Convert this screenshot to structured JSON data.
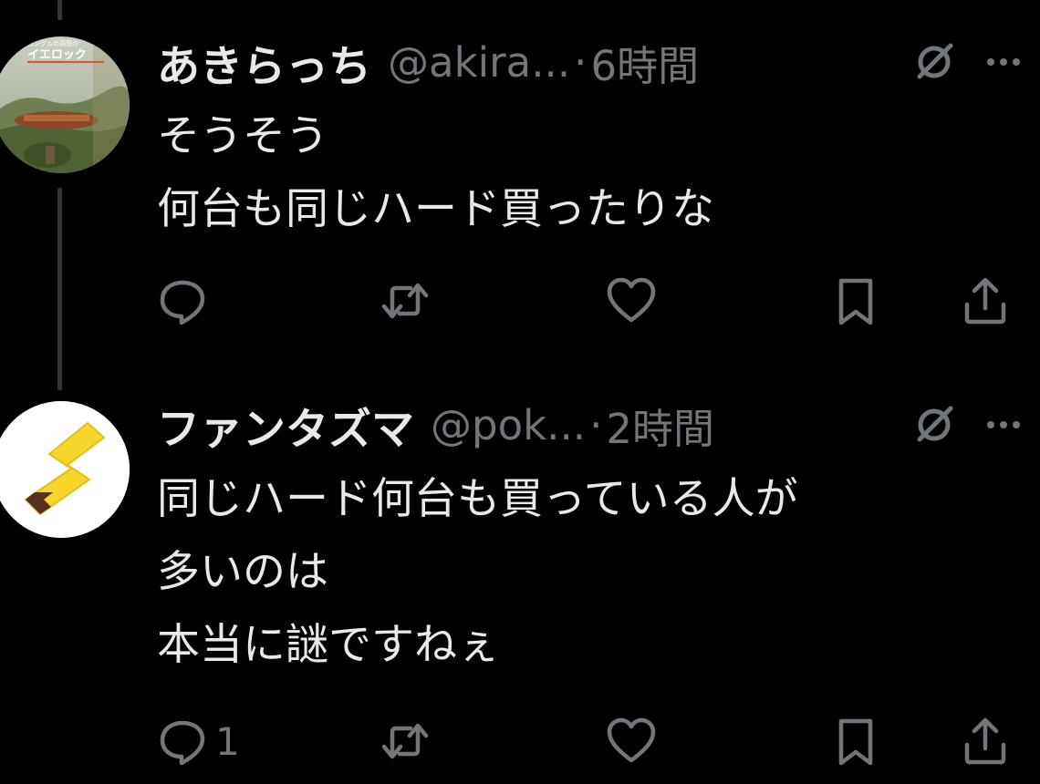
{
  "posts": [
    {
      "display_name": "あきらっち",
      "handle": "@akira...",
      "separator": "·",
      "time": "6時間",
      "avatar": {
        "type": "game-screenshot",
        "caption_small": "ゴングルの洞窟の",
        "caption_large": "イエロック"
      },
      "lines": [
        "そうそう",
        "何台も同じハード買ったりな"
      ],
      "actions": {
        "reply_count": "",
        "repost_count": "",
        "like_count": ""
      }
    },
    {
      "display_name": "ファンタズマ",
      "handle": "@pok...",
      "separator": "·",
      "time": "2時間",
      "avatar": {
        "type": "pikachu-tail"
      },
      "lines": [
        "同じハード何台も買っている人が",
        "多いのは",
        "本当に謎ですねぇ"
      ],
      "actions": {
        "reply_count": "1",
        "repost_count": "",
        "like_count": ""
      }
    }
  ],
  "icons": {
    "header": [
      "grok-icon",
      "more-icon"
    ],
    "actions": [
      "reply-icon",
      "repost-icon",
      "like-icon",
      "bookmark-icon",
      "share-icon"
    ]
  },
  "colors": {
    "background": "#000000",
    "primary_text": "#e7e9ea",
    "secondary_text": "#71767b",
    "thread_line": "#333639",
    "pikachu_yellow": "#f7d72b",
    "pikachu_brown": "#5a2f1c"
  }
}
